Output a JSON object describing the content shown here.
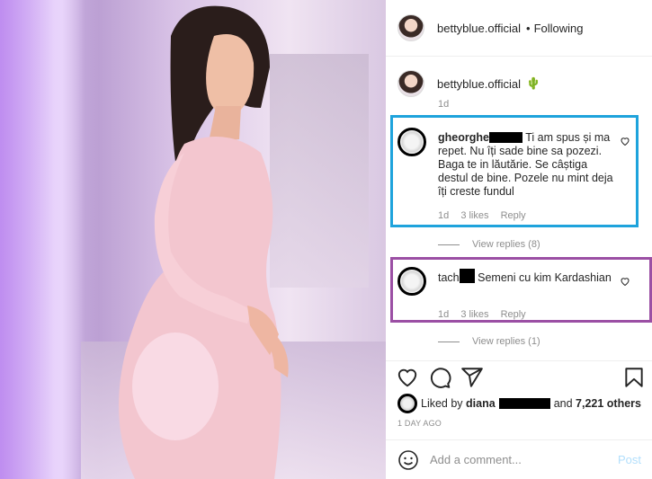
{
  "header": {
    "username": "bettyblue.official",
    "separator": "•",
    "follow_state": "Following"
  },
  "caption": {
    "username": "bettyblue.official",
    "emoji": "🌵",
    "time": "1d"
  },
  "comments": [
    {
      "username": "gheorghe",
      "text": "Ti am spus și ma repet. Nu îți sade bine sa pozezi. Baga te in lăutărie. Se câștiga destul de bine. Pozele nu mint deja îți creste fundul",
      "time": "1d",
      "likes": "3 likes",
      "reply": "Reply",
      "view_replies": "View replies (8)"
    },
    {
      "username": "tach",
      "text": "Semeni cu kim Kardashian",
      "time": "1d",
      "likes": "3 likes",
      "reply": "Reply",
      "view_replies": "View replies (1)"
    }
  ],
  "likes": {
    "prefix": "Liked by",
    "user": "diana",
    "and": "and",
    "others": "7,221 others"
  },
  "post_time": "1 DAY AGO",
  "add_comment": {
    "placeholder": "Add a comment...",
    "post_label": "Post"
  },
  "icons": [
    "heart-icon",
    "comment-icon",
    "share-icon",
    "bookmark-icon",
    "emoji-icon"
  ],
  "colors": {
    "highlight_blue": "#1ea3dc",
    "highlight_purple": "#9b4fa4",
    "post_disabled": "#b2dffc",
    "meta_gray": "#8e8e8e"
  }
}
